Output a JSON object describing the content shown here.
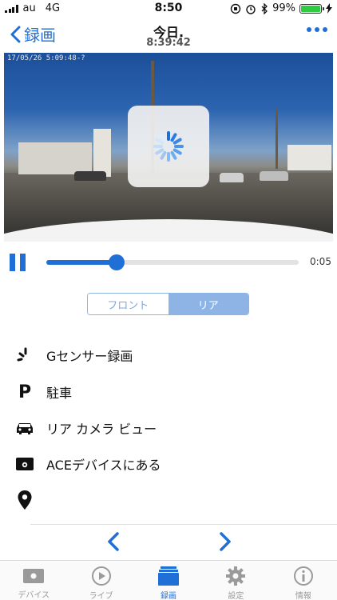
{
  "status_bar": {
    "carrier": "au",
    "network": "4G",
    "time": "8:50",
    "battery_percent": "99%",
    "battery_level": 0.99
  },
  "nav": {
    "back_label": "録画",
    "title": "今日.",
    "subtitle": "8:39:42"
  },
  "video": {
    "overlay_timestamp": "17/05/26 5:09:48-?",
    "loading": true
  },
  "player": {
    "progress": 0.28,
    "time_label": "0:05"
  },
  "segment": {
    "options": [
      "フロント",
      "リア"
    ],
    "selected": "リア"
  },
  "details": [
    {
      "icon": "g-sensor-icon",
      "label": "Gセンサー録画"
    },
    {
      "icon": "parking-icon",
      "label": "駐車"
    },
    {
      "icon": "car-icon",
      "label": "リア カメラ ビュー"
    },
    {
      "icon": "device-icon",
      "label": "ACEデバイスにある"
    },
    {
      "icon": "location-pin-icon",
      "label": ""
    }
  ],
  "tabs": [
    {
      "label": "デバイス",
      "icon": "device-tab-icon",
      "active": false
    },
    {
      "label": "ライブ",
      "icon": "play-circle-icon",
      "active": false
    },
    {
      "label": "録画",
      "icon": "recordings-icon",
      "active": true
    },
    {
      "label": "設定",
      "icon": "gear-icon",
      "active": false
    },
    {
      "label": "情報",
      "icon": "info-icon",
      "active": false
    }
  ],
  "colors": {
    "accent": "#1f6fd6",
    "segment_selected": "#8eb4e6",
    "tab_inactive": "#9a9a9a"
  }
}
